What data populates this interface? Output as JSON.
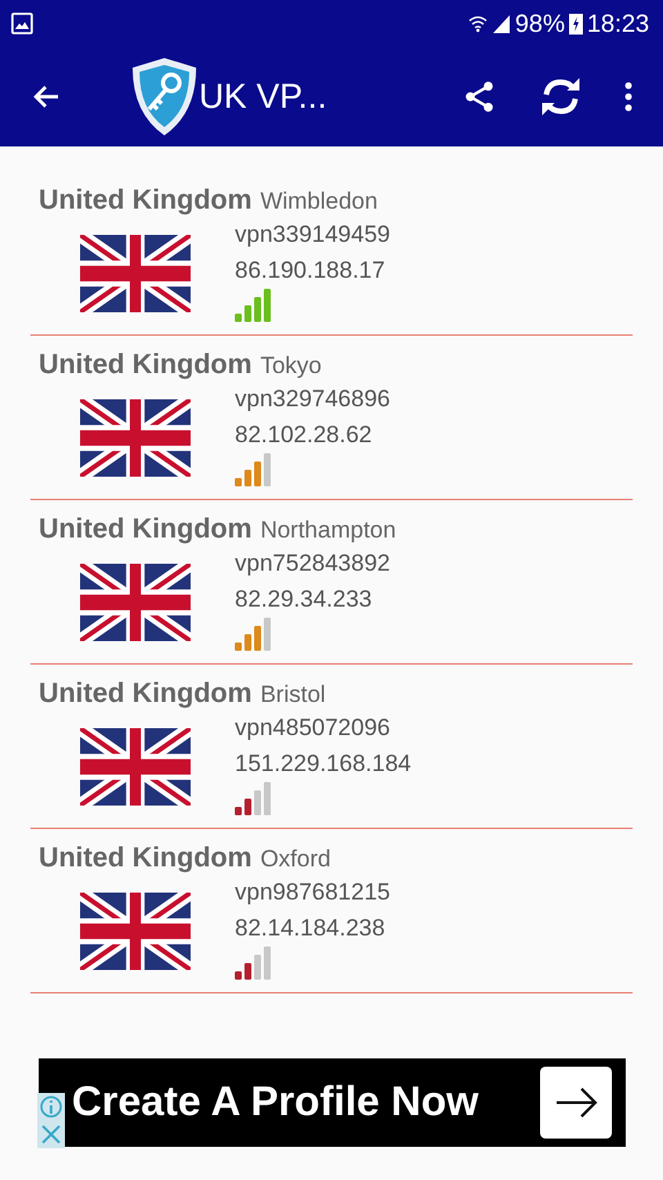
{
  "status_bar": {
    "battery": "98%",
    "time": "18:23"
  },
  "app_bar": {
    "title": "UK VP..."
  },
  "servers": [
    {
      "country": "United Kingdom",
      "city": "Wimbledon",
      "host": "vpn339149459",
      "ip": "86.190.188.17",
      "color": "#6abf1e",
      "bars": [
        {
          "filled": true
        },
        {
          "filled": true
        },
        {
          "filled": true
        },
        {
          "filled": true
        }
      ]
    },
    {
      "country": "United Kingdom",
      "city": "Tokyo",
      "host": "vpn329746896",
      "ip": "82.102.28.62",
      "color": "#dc8a1c",
      "bars": [
        {
          "filled": true
        },
        {
          "filled": true
        },
        {
          "filled": true
        },
        {
          "filled": false
        }
      ]
    },
    {
      "country": "United Kingdom",
      "city": "Northampton",
      "host": "vpn752843892",
      "ip": "82.29.34.233",
      "color": "#dc8a1c",
      "bars": [
        {
          "filled": true
        },
        {
          "filled": true
        },
        {
          "filled": true
        },
        {
          "filled": false
        }
      ]
    },
    {
      "country": "United Kingdom",
      "city": "Bristol",
      "host": "vpn485072096",
      "ip": "151.229.168.184",
      "color": "#b5202e",
      "bars": [
        {
          "filled": true
        },
        {
          "filled": true
        },
        {
          "filled": false
        },
        {
          "filled": false
        }
      ]
    },
    {
      "country": "United Kingdom",
      "city": "Oxford",
      "host": "vpn987681215",
      "ip": "82.14.184.238",
      "color": "#b5202e",
      "bars": [
        {
          "filled": true
        },
        {
          "filled": true
        },
        {
          "filled": false
        },
        {
          "filled": false
        }
      ]
    }
  ],
  "ad": {
    "text": "Create A Profile Now"
  }
}
